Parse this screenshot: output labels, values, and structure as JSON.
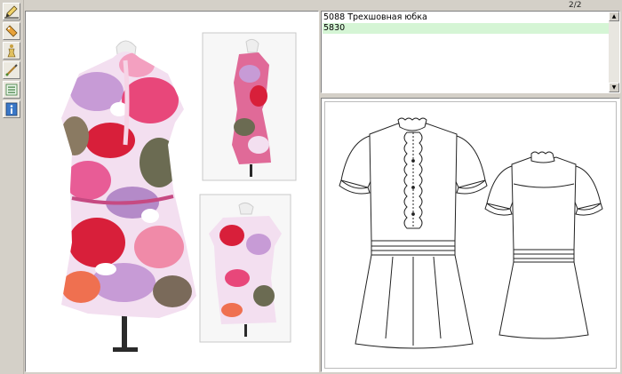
{
  "window": {
    "counter": "2/2"
  },
  "toolbar": {
    "tools": [
      {
        "icon": "pencil-icon"
      },
      {
        "icon": "tag-icon"
      },
      {
        "icon": "mannequin-icon"
      },
      {
        "icon": "brush-icon"
      },
      {
        "icon": "list-icon"
      },
      {
        "icon": "info-icon"
      }
    ]
  },
  "models": {
    "items": [
      {
        "label": "5088 Трехшовная юбка",
        "selected": false
      },
      {
        "label": "5830",
        "selected": true
      }
    ]
  },
  "colors": {
    "selection": "#d5f5d5",
    "print_pink": "#e8477a",
    "print_lilac": "#c79bd6",
    "print_red": "#d81f3a"
  }
}
